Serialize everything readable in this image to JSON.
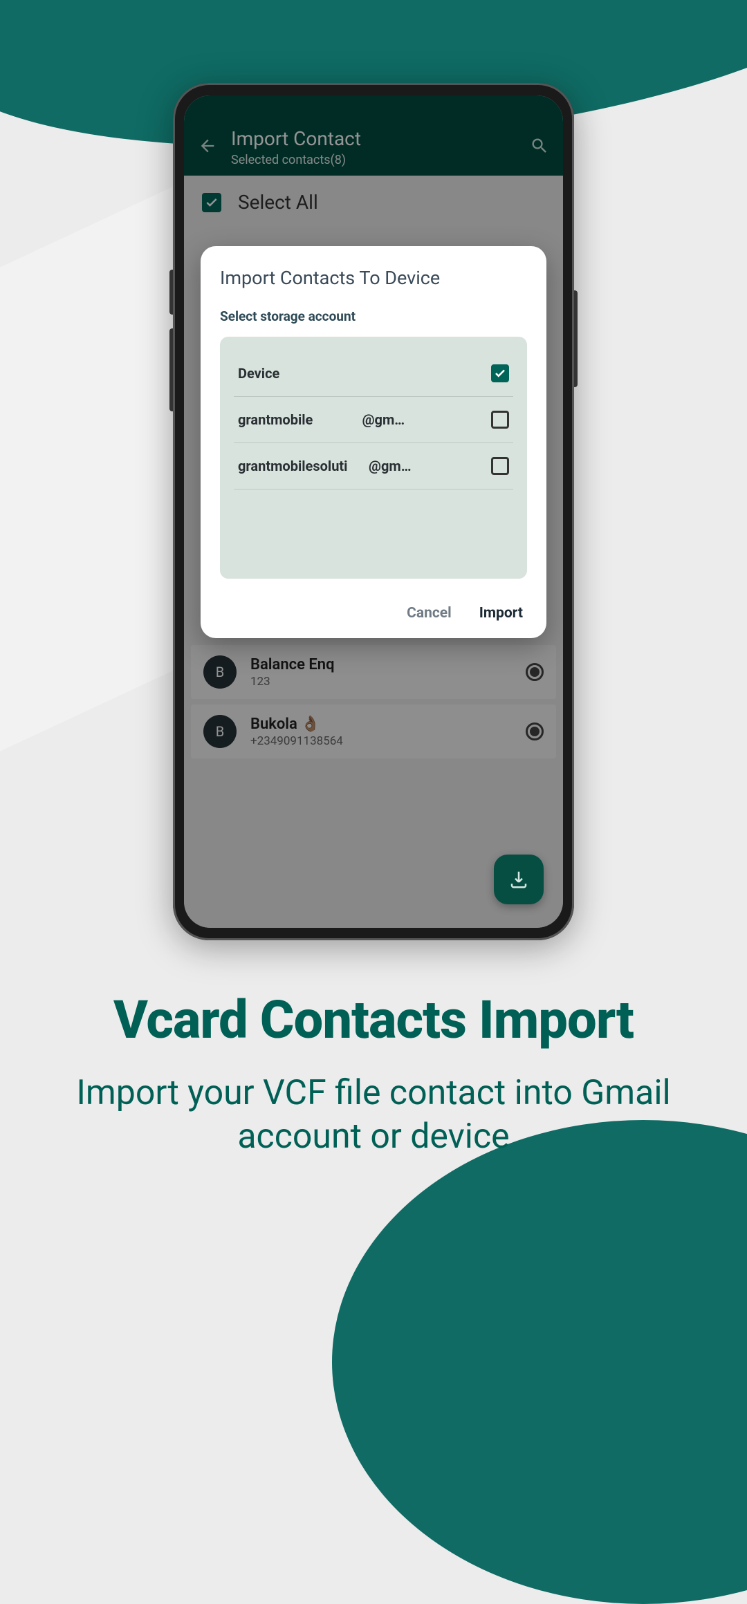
{
  "appBar": {
    "title": "Import Contact",
    "subtitle": "Selected contacts(8)"
  },
  "selectAll": {
    "label": "Select All"
  },
  "contacts": [
    {
      "initial": "B",
      "name": "Balance Enq",
      "phone": "123"
    },
    {
      "initial": "B",
      "name": "Bukola 👌🏽",
      "phone": "+2349091138564"
    }
  ],
  "dialog": {
    "title": "Import Contacts To Device",
    "subtitle": "Select storage account",
    "options": [
      {
        "label": "Device",
        "checked": true
      },
      {
        "prefix": "grantmobile",
        "suffix": "@gm…",
        "checked": false
      },
      {
        "prefix": "grantmobilesoluti",
        "suffix": "@gm…",
        "checked": false
      }
    ],
    "cancel": "Cancel",
    "import": "Import"
  },
  "marketing": {
    "title": "Vcard Contacts Import",
    "subtitle": "Import your VCF file contact into Gmail account or device"
  }
}
